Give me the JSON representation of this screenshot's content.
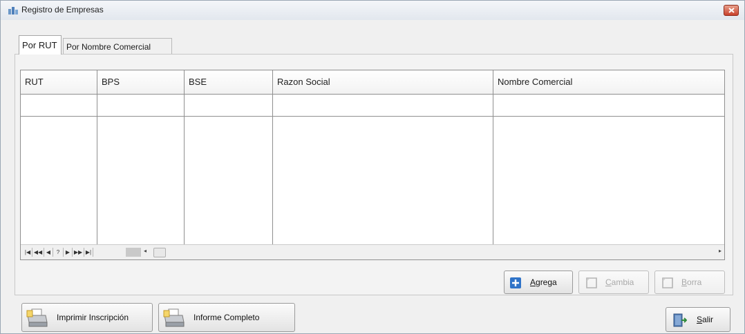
{
  "window": {
    "title": "Registro de Empresas"
  },
  "tabs": [
    {
      "label": "Por RUT",
      "active": true
    },
    {
      "label": "Por Nombre Comercial",
      "active": false
    }
  ],
  "grid": {
    "columns": [
      "RUT",
      "BPS",
      "BSE",
      "Razon Social",
      "Nombre Comercial"
    ],
    "rows": [],
    "navigator": {
      "first": "|◀",
      "prev_page": "◀◀",
      "prev": "◀",
      "position": "?",
      "next": "▶",
      "next_page": "▶▶",
      "last": "▶|"
    }
  },
  "actions": {
    "add": {
      "label_u": "A",
      "label_rest": "grega",
      "enabled": true
    },
    "change": {
      "label_u": "C",
      "label_rest": "ambia",
      "enabled": false
    },
    "delete": {
      "label_u": "B",
      "label_rest": "orra",
      "enabled": false
    }
  },
  "footer": {
    "print_label": "Imprimir Inscripción",
    "report_label": "Informe Completo",
    "exit": {
      "label_u": "S",
      "label_rest": "alir"
    }
  },
  "colors": {
    "accent": "#2f73c8",
    "close": "#c8412c"
  }
}
